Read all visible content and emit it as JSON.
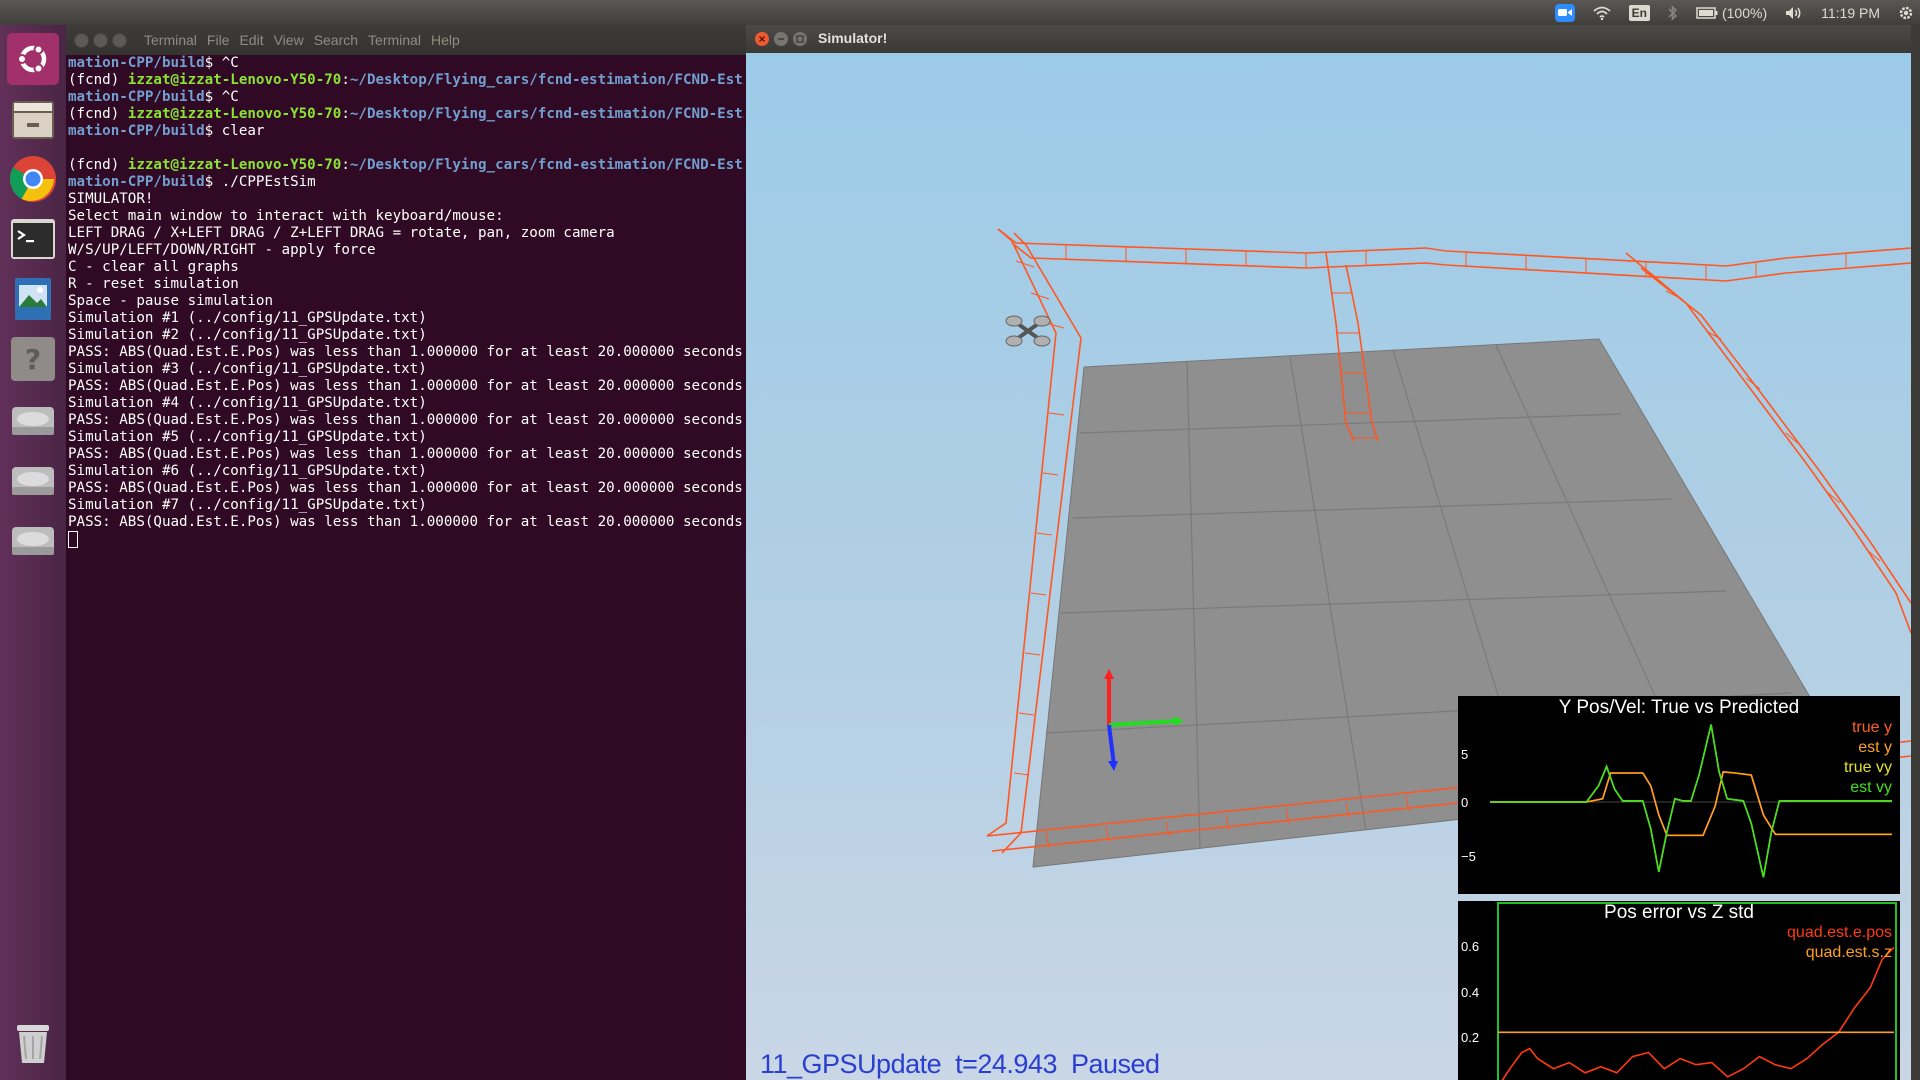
{
  "top_panel": {
    "battery": "(100%)",
    "clock": "11:19 PM",
    "keyboard_layout": "En",
    "icons": [
      "zoom-icon",
      "wifi-icon",
      "keyboard-icon",
      "bluetooth-icon",
      "battery-icon",
      "volume-icon",
      "settings-icon"
    ]
  },
  "launcher": {
    "items": [
      "ubuntu-dash-icon",
      "files-icon",
      "chrome-icon",
      "terminal-icon",
      "image-viewer-icon",
      "help-icon",
      "drive-icon",
      "drive-icon",
      "drive-icon",
      "trash-icon"
    ]
  },
  "terminal": {
    "title": "Terminal",
    "menu": [
      "File",
      "Edit",
      "View",
      "Search",
      "Terminal",
      "Help"
    ],
    "lines": [
      [
        {
          "t": "mation-CPP/build",
          "c": "p"
        },
        {
          "t": "$ ^C"
        }
      ],
      [
        {
          "t": "(fcnd) "
        },
        {
          "t": "izzat@izzat-Lenovo-Y50-70",
          "c": "u"
        },
        {
          "t": ":",
          "c": ""
        },
        {
          "t": "~/Desktop/Flying_cars/fcnd-estimation/FCND-Esti",
          "c": "p"
        }
      ],
      [
        {
          "t": "mation-CPP/build",
          "c": "p"
        },
        {
          "t": "$ ^C"
        }
      ],
      [
        {
          "t": "(fcnd) "
        },
        {
          "t": "izzat@izzat-Lenovo-Y50-70",
          "c": "u"
        },
        {
          "t": ":"
        },
        {
          "t": "~/Desktop/Flying_cars/fcnd-estimation/FCND-Esti",
          "c": "p"
        }
      ],
      [
        {
          "t": "mation-CPP/build",
          "c": "p"
        },
        {
          "t": "$ clear"
        }
      ],
      [
        {
          "t": ""
        }
      ],
      [
        {
          "t": "(fcnd) "
        },
        {
          "t": "izzat@izzat-Lenovo-Y50-70",
          "c": "u"
        },
        {
          "t": ":"
        },
        {
          "t": "~/Desktop/Flying_cars/fcnd-estimation/FCND-Esti",
          "c": "p"
        }
      ],
      [
        {
          "t": "mation-CPP/build",
          "c": "p"
        },
        {
          "t": "$ ./CPPEstSim"
        }
      ],
      [
        {
          "t": "SIMULATOR!"
        }
      ],
      [
        {
          "t": "Select main window to interact with keyboard/mouse:"
        }
      ],
      [
        {
          "t": "LEFT DRAG / X+LEFT DRAG / Z+LEFT DRAG = rotate, pan, zoom camera"
        }
      ],
      [
        {
          "t": "W/S/UP/LEFT/DOWN/RIGHT - apply force"
        }
      ],
      [
        {
          "t": "C - clear all graphs"
        }
      ],
      [
        {
          "t": "R - reset simulation"
        }
      ],
      [
        {
          "t": "Space - pause simulation"
        }
      ],
      [
        {
          "t": "Simulation #1 (../config/11_GPSUpdate.txt)"
        }
      ],
      [
        {
          "t": "Simulation #2 (../config/11_GPSUpdate.txt)"
        }
      ],
      [
        {
          "t": "PASS: ABS(Quad.Est.E.Pos) was less than 1.000000 for at least 20.000000 seconds"
        }
      ],
      [
        {
          "t": "Simulation #3 (../config/11_GPSUpdate.txt)"
        }
      ],
      [
        {
          "t": "PASS: ABS(Quad.Est.E.Pos) was less than 1.000000 for at least 20.000000 seconds"
        }
      ],
      [
        {
          "t": "Simulation #4 (../config/11_GPSUpdate.txt)"
        }
      ],
      [
        {
          "t": "PASS: ABS(Quad.Est.E.Pos) was less than 1.000000 for at least 20.000000 seconds"
        }
      ],
      [
        {
          "t": "Simulation #5 (../config/11_GPSUpdate.txt)"
        }
      ],
      [
        {
          "t": "PASS: ABS(Quad.Est.E.Pos) was less than 1.000000 for at least 20.000000 seconds"
        }
      ],
      [
        {
          "t": "Simulation #6 (../config/11_GPSUpdate.txt)"
        }
      ],
      [
        {
          "t": "PASS: ABS(Quad.Est.E.Pos) was less than 1.000000 for at least 20.000000 seconds"
        }
      ],
      [
        {
          "t": "Simulation #7 (../config/11_GPSUpdate.txt)"
        }
      ],
      [
        {
          "t": "PASS: ABS(Quad.Est.E.Pos) was less than 1.000000 for at least 20.000000 seconds"
        }
      ]
    ]
  },
  "simulator": {
    "title": "Simulator!",
    "status": "11_GPSUpdate  t=24.943  Paused",
    "colors": {
      "trajectory": "#ff5722",
      "ground": "#8f8f8f",
      "sky_top": "#9ccbe8",
      "sky_bottom": "#c9d6e6",
      "status": "#2a3fd0"
    }
  },
  "chart_data": [
    {
      "type": "line",
      "title": "Y Pos/Vel: True vs Predicted",
      "yticks": [
        "5",
        "0",
        "−5"
      ],
      "ylim": [
        -8,
        8
      ],
      "series": [
        {
          "name": "true y",
          "color": "#ff6020",
          "points": [
            [
              0,
              0
            ],
            [
              24,
              0
            ],
            [
              28,
              0.3
            ],
            [
              30,
              2.7
            ],
            [
              38,
              2.7
            ],
            [
              40,
              1.5
            ],
            [
              42,
              -1.2
            ],
            [
              44,
              -3.1
            ],
            [
              50,
              -3.1
            ],
            [
              53,
              -3.1
            ],
            [
              56,
              -0.4
            ],
            [
              58,
              2.8
            ],
            [
              61,
              2.7
            ],
            [
              65,
              2.5
            ],
            [
              68,
              -1.2
            ],
            [
              71,
              -3.0
            ],
            [
              100,
              -3.0
            ]
          ]
        },
        {
          "name": "est y",
          "color": "#ffa020",
          "points": [
            [
              0,
              0
            ],
            [
              24,
              0
            ],
            [
              28,
              0.3
            ],
            [
              30,
              2.7
            ],
            [
              38,
              2.7
            ],
            [
              40,
              1.5
            ],
            [
              42,
              -1.2
            ],
            [
              44,
              -3.1
            ],
            [
              50,
              -3.1
            ],
            [
              53,
              -3.1
            ],
            [
              56,
              -0.4
            ],
            [
              58,
              2.8
            ],
            [
              61,
              2.7
            ],
            [
              65,
              2.5
            ],
            [
              68,
              -1.2
            ],
            [
              71,
              -3.0
            ],
            [
              100,
              -3.0
            ]
          ]
        },
        {
          "name": "true vy",
          "color": "#dfe020",
          "points": [
            [
              0,
              0
            ],
            [
              24,
              0
            ],
            [
              27,
              1.5
            ],
            [
              29,
              3.3
            ],
            [
              31,
              1.2
            ],
            [
              33,
              0.1
            ],
            [
              38,
              0.1
            ],
            [
              40,
              -2.5
            ],
            [
              42,
              -6.5
            ],
            [
              44,
              -2.8
            ],
            [
              46,
              0.3
            ],
            [
              48,
              0.1
            ],
            [
              50,
              0.1
            ],
            [
              52,
              2.5
            ],
            [
              55,
              7.2
            ],
            [
              57,
              2.8
            ],
            [
              59,
              0.3
            ],
            [
              63,
              0.1
            ],
            [
              65,
              -2.0
            ],
            [
              68,
              -7.0
            ],
            [
              70,
              -2.8
            ],
            [
              72,
              0.1
            ],
            [
              100,
              0.1
            ]
          ]
        },
        {
          "name": "est vy",
          "color": "#40e020",
          "points": [
            [
              0,
              0
            ],
            [
              24,
              0
            ],
            [
              27,
              1.5
            ],
            [
              29,
              3.3
            ],
            [
              31,
              1.2
            ],
            [
              33,
              0.1
            ],
            [
              38,
              0.1
            ],
            [
              40,
              -2.5
            ],
            [
              42,
              -6.5
            ],
            [
              44,
              -2.8
            ],
            [
              46,
              0.3
            ],
            [
              48,
              0.1
            ],
            [
              50,
              0.1
            ],
            [
              52,
              2.5
            ],
            [
              55,
              7.2
            ],
            [
              57,
              2.8
            ],
            [
              59,
              0.3
            ],
            [
              63,
              0.1
            ],
            [
              65,
              -2.0
            ],
            [
              68,
              -7.0
            ],
            [
              70,
              -2.8
            ],
            [
              72,
              0.1
            ],
            [
              100,
              0.1
            ]
          ]
        }
      ]
    },
    {
      "type": "line",
      "title": "Pos error vs Z std",
      "yticks": [
        "0.6",
        "0.4",
        "0.2"
      ],
      "ylim": [
        0,
        0.85
      ],
      "series": [
        {
          "name": "quad.est.e.pos",
          "color": "#ff3a10",
          "points": [
            [
              0,
              0.03
            ],
            [
              3,
              0.12
            ],
            [
              6,
              0.2
            ],
            [
              8,
              0.22
            ],
            [
              10,
              0.17
            ],
            [
              14,
              0.12
            ],
            [
              18,
              0.15
            ],
            [
              22,
              0.1
            ],
            [
              26,
              0.13
            ],
            [
              30,
              0.1
            ],
            [
              34,
              0.18
            ],
            [
              38,
              0.2
            ],
            [
              42,
              0.12
            ],
            [
              46,
              0.17
            ],
            [
              50,
              0.14
            ],
            [
              54,
              0.15
            ],
            [
              58,
              0.08
            ],
            [
              62,
              0.12
            ],
            [
              66,
              0.18
            ],
            [
              70,
              0.14
            ],
            [
              74,
              0.12
            ],
            [
              78,
              0.17
            ],
            [
              82,
              0.24
            ],
            [
              86,
              0.3
            ],
            [
              90,
              0.42
            ],
            [
              94,
              0.52
            ],
            [
              97,
              0.66
            ],
            [
              100,
              0.72
            ]
          ]
        },
        {
          "name": "quad.est.s.z",
          "color": "#ffa020",
          "points": [
            [
              0,
              0.3
            ],
            [
              100,
              0.3
            ]
          ]
        }
      ]
    }
  ]
}
